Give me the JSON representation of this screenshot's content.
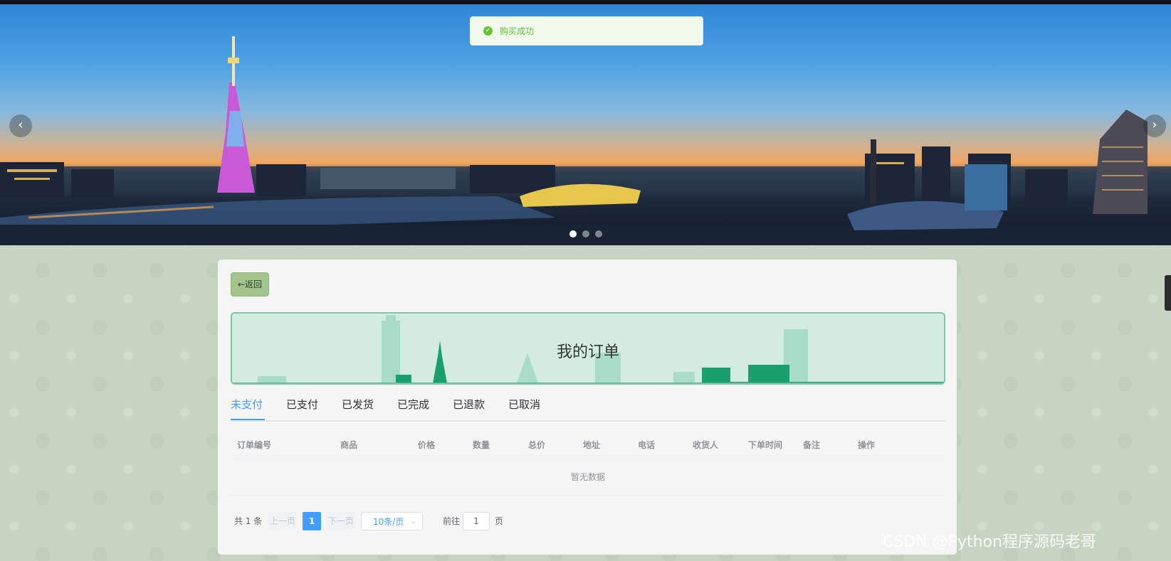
{
  "toast": {
    "message": "购买成功",
    "icon": "check-circle-icon"
  },
  "carousel": {
    "prev_icon": "‹",
    "next_icon": "›",
    "slides": 3,
    "active_index": 0
  },
  "back_button": {
    "label": "←返回"
  },
  "page_title": "我的订单",
  "tabs": [
    {
      "label": "未支付",
      "active": true
    },
    {
      "label": "已支付",
      "active": false
    },
    {
      "label": "已发货",
      "active": false
    },
    {
      "label": "已完成",
      "active": false
    },
    {
      "label": "已退款",
      "active": false
    },
    {
      "label": "已取消",
      "active": false
    }
  ],
  "table": {
    "columns": [
      "订单编号",
      "商品",
      "价格",
      "数量",
      "总价",
      "地址",
      "电话",
      "收货人",
      "下单时间",
      "备注",
      "操作"
    ],
    "empty_text": "暂无数据"
  },
  "pagination": {
    "total_text": "共 1 条",
    "prev_label": "上一页",
    "current_page": "1",
    "next_label": "下一页",
    "page_size": "10条/页",
    "goto_label": "前往",
    "goto_value": "1",
    "page_suffix": "页"
  },
  "watermark": "CSDN @Python程序源码老哥",
  "colors": {
    "accent": "#409eff",
    "success": "#67c23a",
    "back_button": "#a3c58d",
    "title_banner": "#d4ece0"
  }
}
